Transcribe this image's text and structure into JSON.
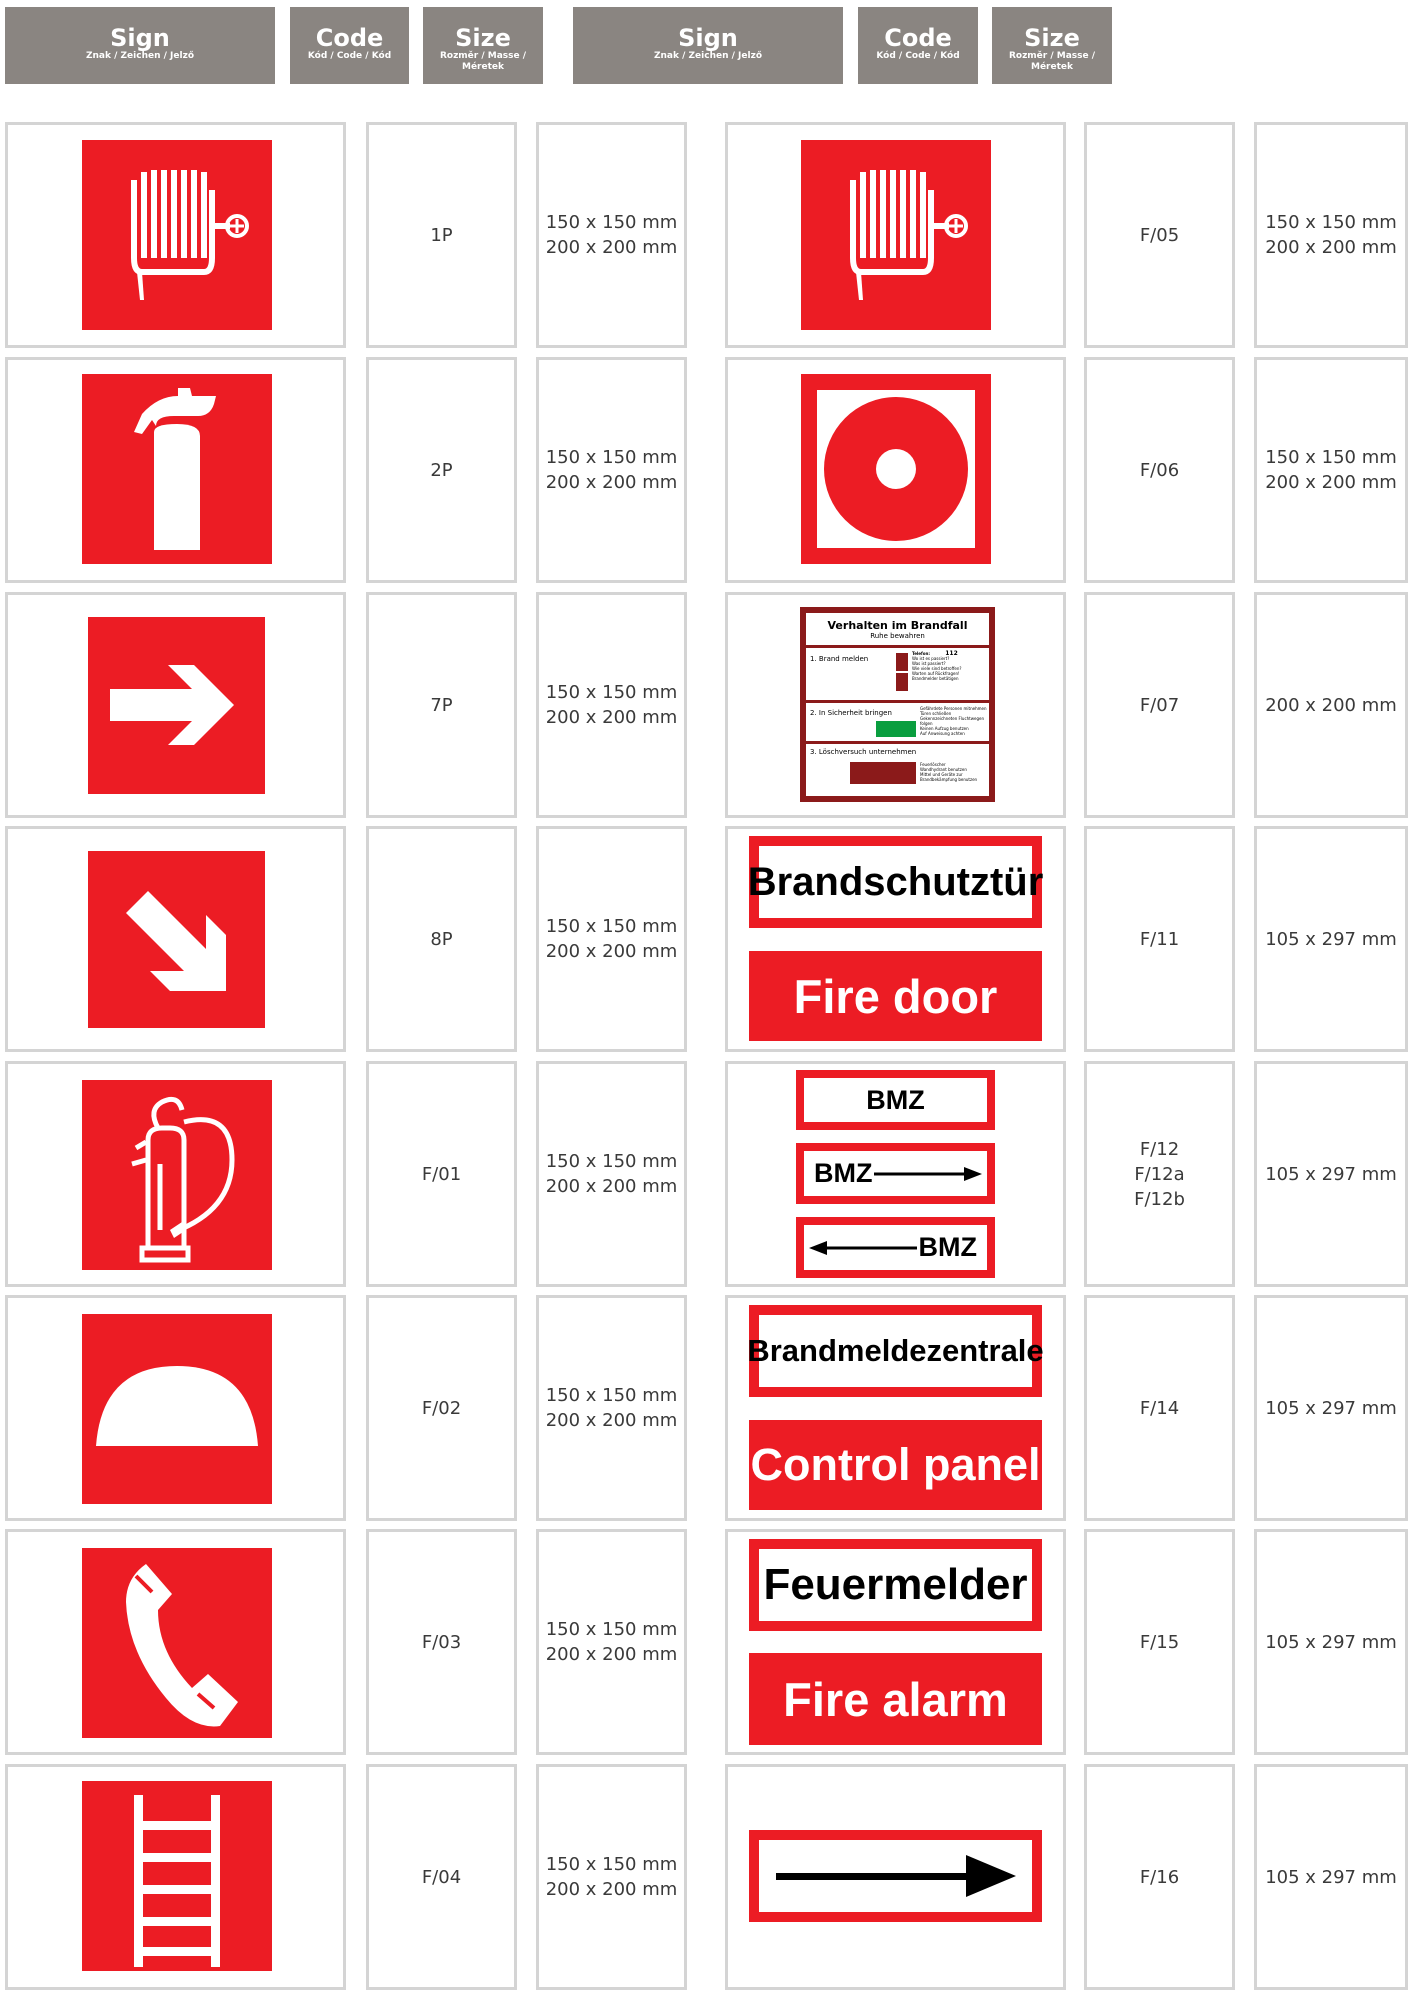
{
  "headers": [
    {
      "title": "Sign",
      "subtitle": "Znak / Zeichen / Jelző"
    },
    {
      "title": "Code",
      "subtitle": "Kód / Code / Kód"
    },
    {
      "title": "Size",
      "subtitle": "Rozměr / Masse / Méretek"
    },
    {
      "title": "Sign",
      "subtitle": "Znak / Zeichen / Jelző"
    },
    {
      "title": "Code",
      "subtitle": "Kód / Code / Kód"
    },
    {
      "title": "Size",
      "subtitle": "Rozměr / Masse / Méretek"
    }
  ],
  "left_rows": [
    {
      "code": "1P",
      "size": "150 x 150 mm\n200 x 200 mm",
      "icon": "fire-hose-reel-icon"
    },
    {
      "code": "2P",
      "size": "150 x 150 mm\n200 x 200 mm",
      "icon": "fire-extinguisher-icon"
    },
    {
      "code": "7P",
      "size": "150 x 150 mm\n200 x 200 mm",
      "icon": "arrow-right-icon"
    },
    {
      "code": "8P",
      "size": "150 x 150 mm\n200 x 200 mm",
      "icon": "arrow-down-right-icon"
    },
    {
      "code": "F/01",
      "size": "150 x 150 mm\n200 x 200 mm",
      "icon": "wheeled-extinguisher-icon"
    },
    {
      "code": "F/02",
      "size": "150 x 150 mm\n200 x 200 mm",
      "icon": "fire-blanket-icon"
    },
    {
      "code": "F/03",
      "size": "150 x 150 mm\n200 x 200 mm",
      "icon": "emergency-phone-icon"
    },
    {
      "code": "F/04",
      "size": "150 x 150 mm\n200 x 200 mm",
      "icon": "fire-ladder-icon"
    }
  ],
  "right_rows": [
    {
      "code": "F/05",
      "size": "150 x 150 mm\n200 x 200 mm",
      "icon": "fire-hose-reel-icon"
    },
    {
      "code": "F/06",
      "size": "150 x 150 mm\n200 x 200 mm",
      "icon": "fire-alarm-button-icon"
    },
    {
      "code": "F/07",
      "size": "200 x 200 mm",
      "icon": "fire-instructions-icon"
    },
    {
      "code": "F/11",
      "size": "105 x 297 mm",
      "icon": "text-sign"
    },
    {
      "code": "F/12\nF/12a\nF/12b",
      "size": "105 x 297 mm",
      "icon": "text-sign"
    },
    {
      "code": "F/14",
      "size": "105 x 297 mm",
      "icon": "text-sign"
    },
    {
      "code": "F/15",
      "size": "105 x 297 mm",
      "icon": "text-sign"
    },
    {
      "code": "F/16",
      "size": "105 x 297 mm",
      "icon": "arrow-right-icon"
    }
  ],
  "sign_texts": {
    "f11_top": "Brandschutztür",
    "f11_bottom": "Fire door",
    "f12": "BMZ",
    "f14_top": "Brandmeldezentrale",
    "f14_bottom": "Control panel",
    "f15_top": "Feuermelder",
    "f15_bottom": "Fire alarm"
  },
  "instructions_sign": {
    "title": "Verhalten im Brandfall",
    "subtitle": "Ruhe bewahren",
    "step1": "1. Brand melden",
    "step1_phone_label": "Telefon:",
    "step1_phone": "112",
    "step1_lines": [
      "Wo ist es passiert?",
      "Was ist passiert?",
      "Wie viele sind betroffen?",
      "Warten auf Rückfragen!",
      "Brandmelder betätigen"
    ],
    "step2": "2. In Sicherheit bringen",
    "step2_lines": [
      "Gefährdete Personen mitnehmen",
      "Türen schließen",
      "Gekennzeichneten Fluchtwegen folgen",
      "Keinen Aufzug benutzen",
      "Auf Anweisung achten"
    ],
    "step3": "3. Löschversuch unternehmen",
    "step3_lines": [
      "Feuerlöscher",
      "Wandhydrant benutzen",
      "Mittel und Geräte zur Brandbekämpfung benutzen"
    ]
  },
  "colors": {
    "red": "#ec1c24",
    "header_gray": "#8a8581",
    "border_gray": "#d4d4d4",
    "dark_red": "#8b1a1a",
    "green": "#0a9e3f"
  }
}
